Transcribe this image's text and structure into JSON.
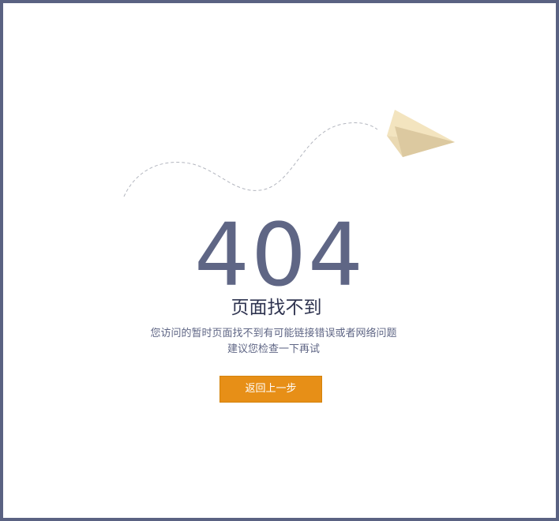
{
  "error": {
    "code": "404",
    "title": "页面找不到",
    "description_line1": "您访问的暂时页面找不到有可能链接错误或者网络问题",
    "description_line2": "建议您检查一下再试"
  },
  "actions": {
    "back_label": "返回上一步"
  },
  "colors": {
    "frame_border": "#5a6282",
    "code_text": "#5f6685",
    "title_text": "#2f3450",
    "button_bg": "#e78f17",
    "plane_light": "#f3e4bf",
    "plane_dark": "#dcc9a0"
  },
  "icons": {
    "illustration": "paper-plane-icon"
  }
}
